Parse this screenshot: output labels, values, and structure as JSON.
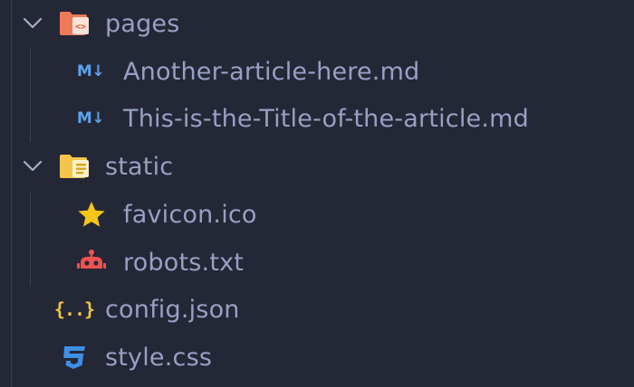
{
  "explorer": {
    "items": [
      {
        "label": "pages",
        "icon": "folder-pages-open-icon",
        "type": "folder",
        "expanded": true
      },
      {
        "label": "Another-article-here.md",
        "icon": "markdown-icon",
        "type": "file"
      },
      {
        "label": "This-is-the-Title-of-the-article.md",
        "icon": "markdown-icon",
        "type": "file"
      },
      {
        "label": "static",
        "icon": "folder-static-open-icon",
        "type": "folder",
        "expanded": true
      },
      {
        "label": "favicon.ico",
        "icon": "star-icon",
        "type": "file"
      },
      {
        "label": "robots.txt",
        "icon": "robot-icon",
        "type": "file"
      },
      {
        "label": "config.json",
        "icon": "json-icon",
        "type": "file"
      },
      {
        "label": "style.css",
        "icon": "css-icon",
        "type": "file"
      }
    ],
    "icon_glyphs": {
      "markdown": "M↓",
      "json": "{..}"
    }
  },
  "colors": {
    "background": "#242736",
    "label": "#98a0c4",
    "indent_guide": "#3a3e50",
    "markdown": "#5aa2f0",
    "json": "#f1c34a",
    "css": "#3f8fe6",
    "star": "#f5c518",
    "robot": "#ef5350",
    "folder_pages": "#ef7a5a",
    "folder_static": "#f4c44d"
  }
}
